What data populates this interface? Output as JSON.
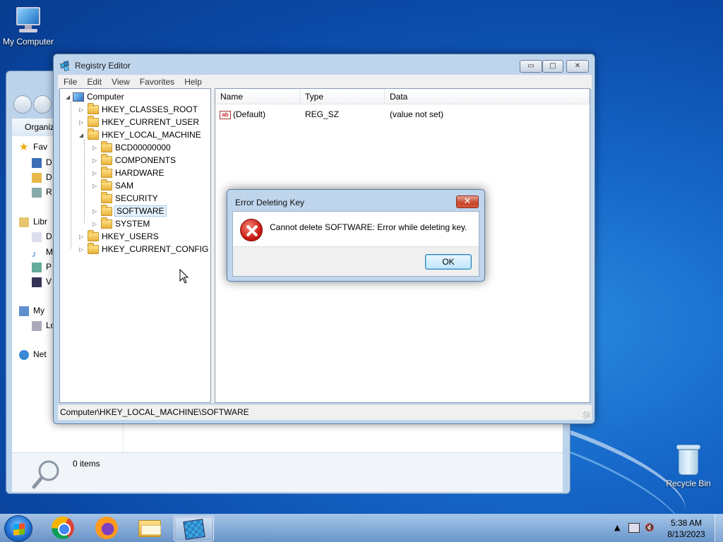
{
  "desktop": {
    "icons": [
      {
        "label": "My Computer",
        "icon": "computer-icon"
      },
      {
        "label": "Recycle Bin",
        "icon": "recycle-bin-icon"
      }
    ]
  },
  "explorer": {
    "toolbar_label": "Organiz",
    "items": [
      "Fav",
      "D",
      "D",
      "R",
      "Libr",
      "D",
      "M",
      "P",
      "V",
      "My",
      "Lo",
      "Net"
    ],
    "status_text": "0 items"
  },
  "regedit": {
    "title": "Registry Editor",
    "caption_buttons": {
      "minimize": "▭",
      "maximize": "□",
      "close": "✕"
    },
    "menu": [
      "File",
      "Edit",
      "View",
      "Favorites",
      "Help"
    ],
    "tree": {
      "root": "Computer",
      "hives": [
        "HKEY_CLASSES_ROOT",
        "HKEY_CURRENT_USER",
        "HKEY_LOCAL_MACHINE",
        "HKEY_USERS",
        "HKEY_CURRENT_CONFIG"
      ],
      "local_machine_children": [
        "BCD00000000",
        "COMPONENTS",
        "HARDWARE",
        "SAM",
        "SECURITY",
        "SOFTWARE",
        "SYSTEM"
      ],
      "selected": "SOFTWARE"
    },
    "list": {
      "columns": [
        "Name",
        "Type",
        "Data"
      ],
      "rows": [
        {
          "name": "(Default)",
          "type": "REG_SZ",
          "data": "(value not set)"
        }
      ]
    },
    "status_path": "Computer\\HKEY_LOCAL_MACHINE\\SOFTWARE"
  },
  "dialog": {
    "title": "Error Deleting Key",
    "close_glyph": "✕",
    "message": "Cannot delete SOFTWARE:  Error while deleting key.",
    "ok_label": "OK",
    "icon": "error-icon"
  },
  "taskbar": {
    "apps": [
      "chrome-icon",
      "firefox-icon",
      "file-explorer-icon",
      "registry-editor-icon"
    ],
    "active_app": "registry-editor-icon",
    "time": "5:38 AM",
    "date": "8/13/2023"
  }
}
